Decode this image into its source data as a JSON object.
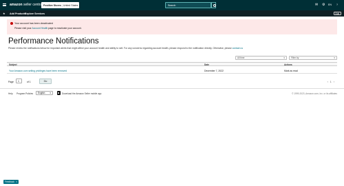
{
  "header": {
    "logo_bold": "amazon",
    "logo_light": "seller central",
    "store_name": "Positive Stores",
    "store_region": "United States",
    "search_placeholder": "Search",
    "icons": [
      "mail-icon",
      "gear-icon",
      "language-icon",
      "help-icon"
    ],
    "language": "EN"
  },
  "nav": {
    "items": [
      "Add Products",
      "Explore Services"
    ],
    "edit_label": "Edit"
  },
  "alert": {
    "title": "Your account has been deactivated",
    "body_prefix": "Please visit your ",
    "body_link": "Account Health",
    "body_suffix": " page to reactivate your account."
  },
  "page": {
    "title": "Performance Notifications",
    "intro": "Please review the notifications below for important alerts that might affect your account health and ability to sell. For any concerns regarding account health, please respond to the notification directly. Otherwise, please ",
    "intro_link": "contact us"
  },
  "filters": {
    "left": "All time",
    "right": "Filter by"
  },
  "table": {
    "headers": [
      "Subject",
      "Date",
      "Actions"
    ],
    "rows": [
      {
        "subject": "Your Amazon.com selling privileges have been removed",
        "date": "December 7, 2022",
        "action": "Mark as read"
      }
    ]
  },
  "pagination": {
    "page_label": "Page",
    "current": "1",
    "of_label": "of 1",
    "go_label": "Go",
    "arrows": "‹ 1 ›"
  },
  "footer": {
    "help": "Help",
    "program_policies": "Program Policies",
    "language": "English",
    "app_text": "Download the Amazon Seller mobile app",
    "copyright": "© 1999-2023, Amazon.com, Inc. or its affiliates"
  },
  "feedback": {
    "label": "Feedback",
    "close": "×"
  },
  "colors": {
    "topbar": "#002f36",
    "alert_bg": "#fde8e8",
    "link": "#007185"
  }
}
